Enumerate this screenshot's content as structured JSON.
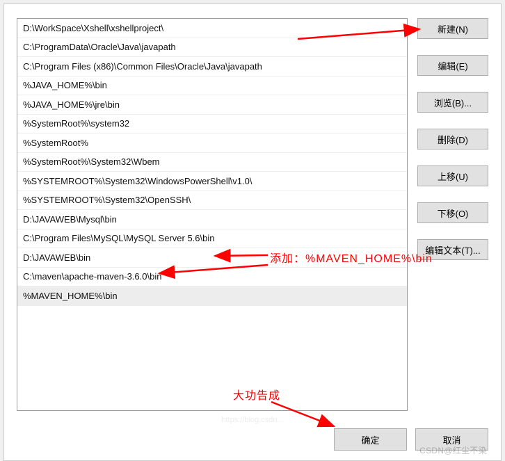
{
  "list": {
    "items": [
      "D:\\WorkSpace\\Xshell\\xshellproject\\",
      "C:\\ProgramData\\Oracle\\Java\\javapath",
      "C:\\Program Files (x86)\\Common Files\\Oracle\\Java\\javapath",
      "%JAVA_HOME%\\bin",
      "%JAVA_HOME%\\jre\\bin",
      "%SystemRoot%\\system32",
      "%SystemRoot%",
      "%SystemRoot%\\System32\\Wbem",
      "%SYSTEMROOT%\\System32\\WindowsPowerShell\\v1.0\\",
      "%SYSTEMROOT%\\System32\\OpenSSH\\",
      "D:\\JAVAWEB\\Mysql\\bin",
      "C:\\Program Files\\MySQL\\MySQL Server 5.6\\bin",
      "D:\\JAVAWEB\\bin",
      "C:\\maven\\apache-maven-3.6.0\\bin",
      "%MAVEN_HOME%\\bin"
    ],
    "selected_index": 14
  },
  "buttons": {
    "new": "新建(N)",
    "edit": "编辑(E)",
    "browse": "浏览(B)...",
    "delete": "删除(D)",
    "move_up": "上移(U)",
    "move_down": "下移(O)",
    "edit_text": "编辑文本(T)..."
  },
  "footer": {
    "ok": "确定",
    "cancel": "取消"
  },
  "annotations": {
    "add_label": "添加：%MAVEN_HOME%\\bin",
    "done_label": "大功告成"
  },
  "watermark": "CSDN@红尘不染",
  "watermark2": "https://blog.csdn..."
}
